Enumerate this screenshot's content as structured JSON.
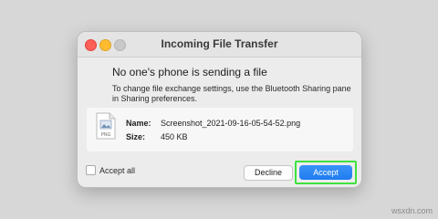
{
  "window": {
    "title": "Incoming File Transfer"
  },
  "message": {
    "heading": "No one's phone is sending a file",
    "description": "To change file exchange settings, use the Bluetooth Sharing pane in Sharing preferences."
  },
  "file": {
    "name_label": "Name:",
    "name_value": "Screenshot_2021-09-16-05-54-52.png",
    "size_label": "Size:",
    "size_value": "450 KB",
    "icon_text": "PNG"
  },
  "options": {
    "accept_all_label": "Accept all",
    "accept_all_checked": false
  },
  "buttons": {
    "decline": "Decline",
    "accept": "Accept"
  },
  "watermark": "wsxdn.com",
  "colors": {
    "accent": "#1f7cf1",
    "highlight": "#3fe23f"
  }
}
